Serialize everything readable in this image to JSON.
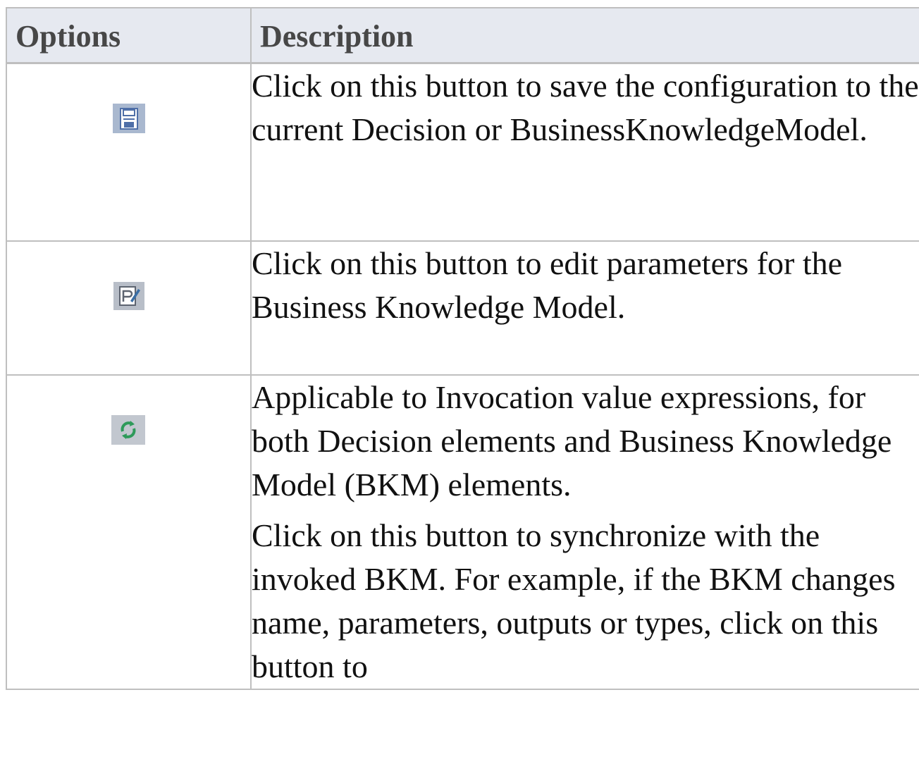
{
  "table": {
    "headers": {
      "options": "Options",
      "description": "Description"
    },
    "rows": [
      {
        "icon": "save-icon",
        "paragraphs": [
          "Click on this button to save the configuration to the current Decision or BusinessKnowledgeModel."
        ]
      },
      {
        "icon": "edit-parameters-icon",
        "paragraphs": [
          "Click on this button to edit parameters for the Business Knowledge Model."
        ]
      },
      {
        "icon": "synchronize-icon",
        "paragraphs": [
          "Applicable to Invocation value expressions, for both Decision elements and Business Knowledge Model (BKM) elements.",
          "Click on this button to synchronize with the invoked BKM. For example, if the BKM changes name, parameters, outputs or types, click on this button to"
        ]
      }
    ]
  },
  "colors": {
    "header_bg": "#e6e9f0",
    "border": "#bfbfbf",
    "header_text": "#474747"
  }
}
